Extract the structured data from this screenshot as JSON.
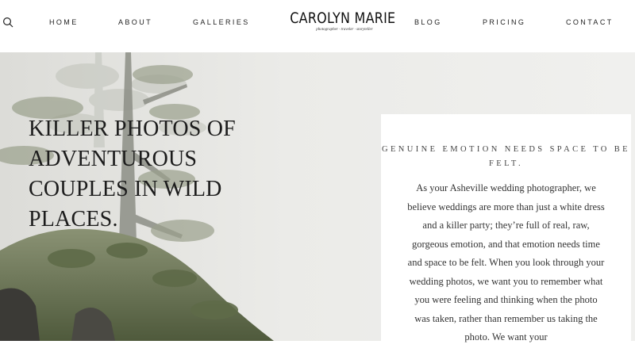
{
  "nav": {
    "left": [
      {
        "label": "HOME"
      },
      {
        "label": "ABOUT"
      },
      {
        "label": "GALLERIES"
      }
    ],
    "right": [
      {
        "label": "BLOG"
      },
      {
        "label": "PRICING"
      },
      {
        "label": "CONTACT"
      }
    ],
    "search_icon": "search-icon"
  },
  "logo": {
    "name": "CAROLYN MARIE",
    "tagline": "photographer · traveler · storyteller"
  },
  "hero": {
    "headline": "KILLER PHOTOS OF ADVENTUROUS COUPLES IN WILD PLACES."
  },
  "card": {
    "heading": "GENUINE EMOTION NEEDS SPACE TO BE FELT.",
    "body": "As your Asheville wedding photographer, we believe weddings are more than just a white dress and a killer party; they’re full of real, raw, gorgeous emotion, and that emotion needs time and space to be felt. When you look through your wedding photos, we want you to remember what you were feeling and thinking when the photo was taken, rather than remember us taking the photo. We want your"
  },
  "colors": {
    "text": "#222222",
    "hero_bg": "#ececea",
    "foliage": "#6f7a5c"
  }
}
